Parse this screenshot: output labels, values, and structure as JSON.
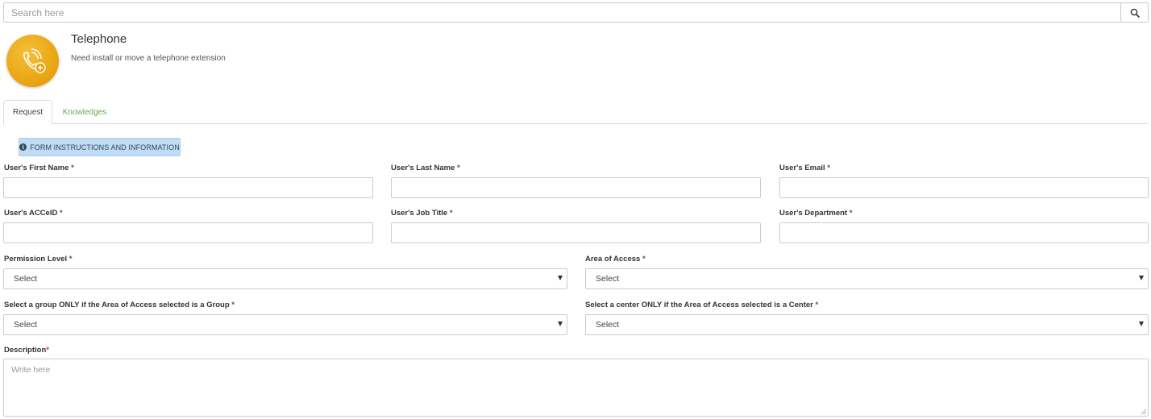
{
  "search": {
    "placeholder": "Search here",
    "icon": "search-icon"
  },
  "service": {
    "title": "Telephone",
    "subtitle": "Need install or move a telephone extension",
    "icon": "phone-add-icon",
    "logo_color": "#e9a20f"
  },
  "tabs": [
    {
      "label": "Request",
      "active": true
    },
    {
      "label": "Knowledges",
      "active": false
    }
  ],
  "info_button": {
    "label": "FORM INSTRUCTIONS AND INFORMATION",
    "icon": "info-icon",
    "color": "#bfdcf3"
  },
  "form": {
    "first_name": {
      "label": "User's First Name",
      "required": "*"
    },
    "last_name": {
      "label": "User's Last Name",
      "required": "*"
    },
    "email": {
      "label": "User's Email",
      "required": "*"
    },
    "acceid": {
      "label": "User's ACCeID",
      "required": "*"
    },
    "job_title": {
      "label": "User's Job Title",
      "required": "*"
    },
    "department": {
      "label": "User's Department",
      "required": "*"
    },
    "permission_level": {
      "label": "Permission Level",
      "required": "*",
      "value": "Select"
    },
    "area_of_access": {
      "label": "Area of Access",
      "required": "*",
      "value": "Select"
    },
    "group": {
      "label": "Select a group ONLY if the Area of Access selected is a Group",
      "required": "*",
      "value": "Select"
    },
    "center": {
      "label": "Select a center ONLY if the Area of Access selected is a Center",
      "required": "*",
      "value": "Select"
    },
    "description": {
      "label": "Description",
      "required": "*",
      "placeholder": "Write here"
    }
  },
  "colors": {
    "knowledges_tab": "#6aa84f",
    "required_marker": "#c9302c",
    "border": "#cccccc"
  }
}
